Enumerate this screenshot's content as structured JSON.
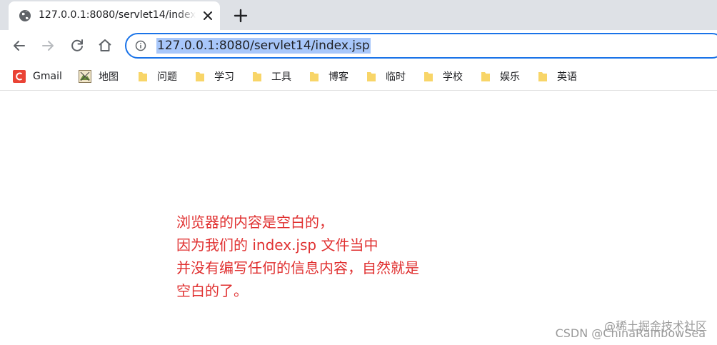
{
  "tab": {
    "title": "127.0.0.1:8080/servlet14/index.jsp"
  },
  "omnibox": {
    "url": "127.0.0.1:8080/servlet14/index.jsp"
  },
  "bookmarks": [
    {
      "label": "Gmail",
      "icon": "gmail-icon"
    },
    {
      "label": "地图",
      "icon": "map-icon"
    },
    {
      "label": "问题",
      "icon": "folder-icon"
    },
    {
      "label": "学习",
      "icon": "folder-icon"
    },
    {
      "label": "工具",
      "icon": "folder-icon"
    },
    {
      "label": "博客",
      "icon": "folder-icon"
    },
    {
      "label": "临时",
      "icon": "folder-icon"
    },
    {
      "label": "学校",
      "icon": "folder-icon"
    },
    {
      "label": "娱乐",
      "icon": "folder-icon"
    },
    {
      "label": "英语",
      "icon": "folder-icon"
    }
  ],
  "content": {
    "annotation_lines": [
      "浏览器的内容是空白的，",
      "因为我们的 index.jsp 文件当中",
      "并没有编写任何的信息内容，自然就是",
      "空白的了。"
    ],
    "watermark_top": "@稀土掘金技术社区",
    "watermark_bottom": "CSDN @ChinaRainbowSea"
  },
  "colors": {
    "annotation": "#e03131",
    "omnibox_border": "#1a73e8",
    "url_highlight": "#a8c7fa",
    "folder": "#f8d568",
    "gmail": "#ea4335"
  }
}
